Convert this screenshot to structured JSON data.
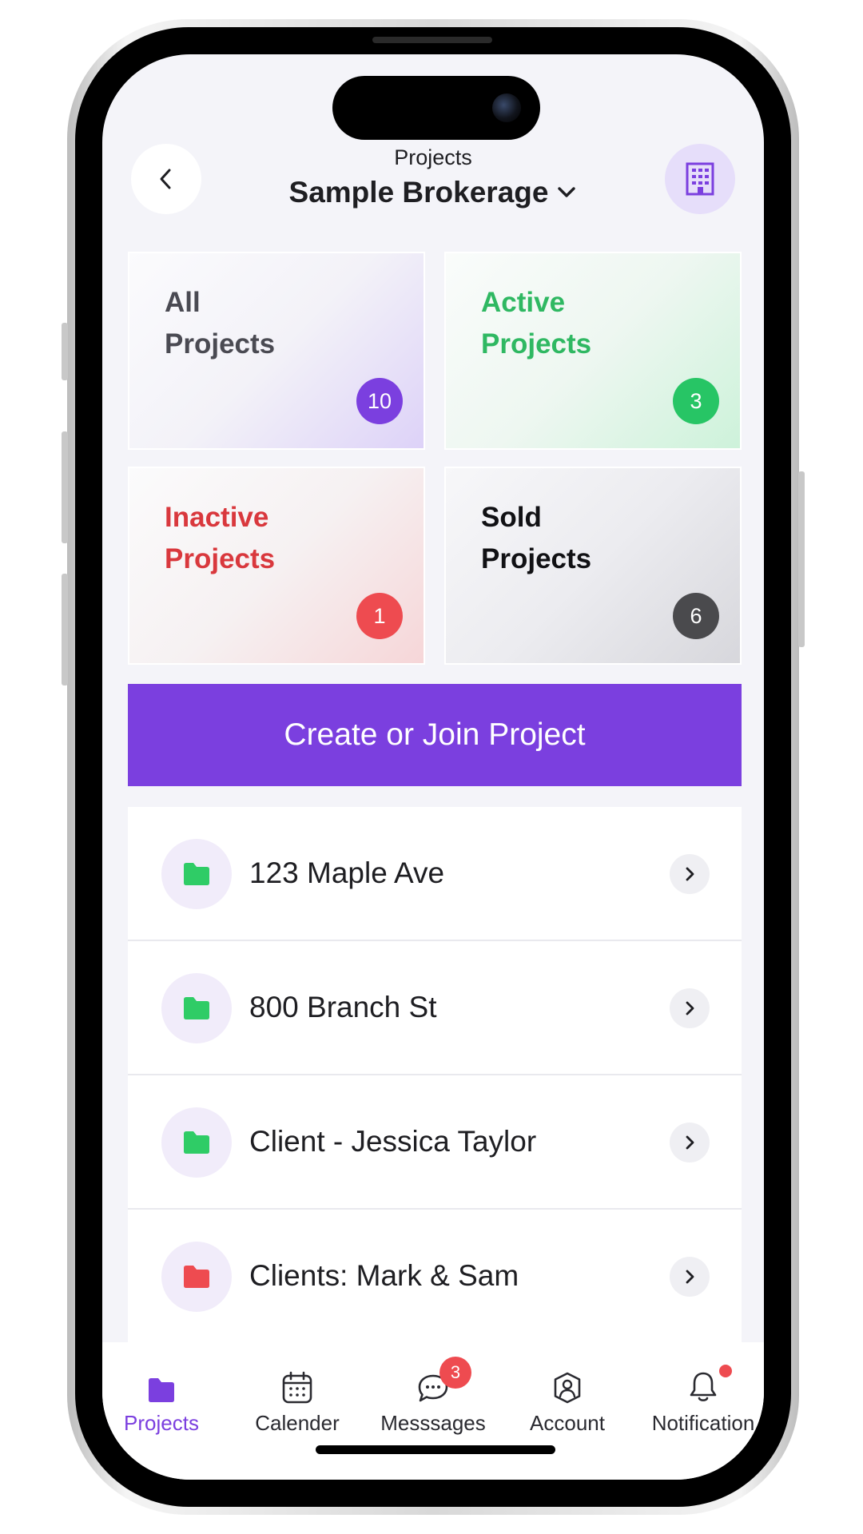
{
  "header": {
    "label": "Projects",
    "title": "Sample Brokerage",
    "back_icon": "chevron-left-icon",
    "right_icon": "building-icon",
    "title_icon": "chevron-down-icon"
  },
  "categories": [
    {
      "title": "All\nProjects",
      "count": "10",
      "title_color": "#4a4a52",
      "badge_color": "#7b3fdf"
    },
    {
      "title": "Active\nProjects",
      "count": "3",
      "title_color": "#2fb862",
      "badge_color": "#27c565"
    },
    {
      "title": "Inactive\nProjects",
      "count": "1",
      "title_color": "#d9383d",
      "badge_color": "#ee4b50"
    },
    {
      "title": "Sold\nProjects",
      "count": "6",
      "title_color": "#111114",
      "badge_color": "#4a4a4d"
    }
  ],
  "create_button": {
    "label": "Create or Join Project",
    "color": "#7b3fdf"
  },
  "projects": [
    {
      "name": "123 Maple Ave",
      "folder_color": "#2fcc66"
    },
    {
      "name": "800 Branch St",
      "folder_color": "#2fcc66"
    },
    {
      "name": "Client - Jessica Taylor",
      "folder_color": "#2fcc66"
    },
    {
      "name": "Clients: Mark & Sam",
      "folder_color": "#ee4b50"
    }
  ],
  "tabbar": {
    "tabs": [
      {
        "label": "Projects",
        "icon": "folder-icon",
        "active": true
      },
      {
        "label": "Calender",
        "icon": "calendar-icon",
        "active": false
      },
      {
        "label": "Messsages",
        "icon": "chat-icon",
        "active": false,
        "badge": "3"
      },
      {
        "label": "Account",
        "icon": "account-icon",
        "active": false
      },
      {
        "label": "Notification",
        "icon": "bell-icon",
        "active": false
      }
    ]
  },
  "colors": {
    "accent": "#7b3fdf",
    "background": "#f4f4f9"
  }
}
